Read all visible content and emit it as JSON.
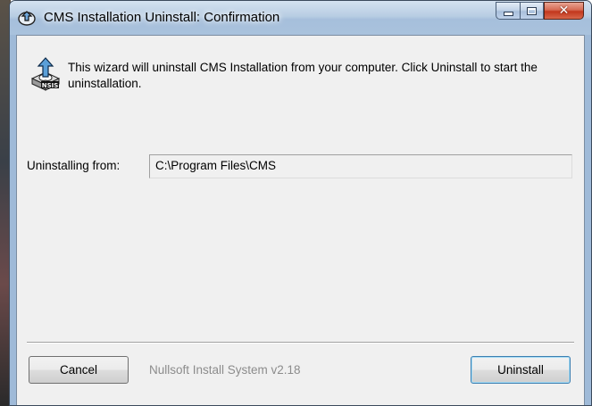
{
  "window": {
    "title": "CMS Installation Uninstall: Confirmation",
    "icon": "nsis-installer-icon"
  },
  "caption_buttons": {
    "minimize": "minimize-icon",
    "maximize": "maximize-icon",
    "close": "close-icon"
  },
  "header": {
    "icon": "nsis-uninstall-icon",
    "text": "This wizard will uninstall CMS Installation from your computer. Click Uninstall to start the uninstallation."
  },
  "form": {
    "from_label": "Uninstalling from:",
    "from_value": "C:\\Program Files\\CMS"
  },
  "footer": {
    "cancel_label": "Cancel",
    "branding": "Nullsoft Install System v2.18",
    "uninstall_label": "Uninstall"
  },
  "colors": {
    "titlebar": "#a9c2dd",
    "close_button": "#c2361c",
    "client_bg": "#f0f0f0",
    "default_button_border": "#3c7fb1"
  }
}
